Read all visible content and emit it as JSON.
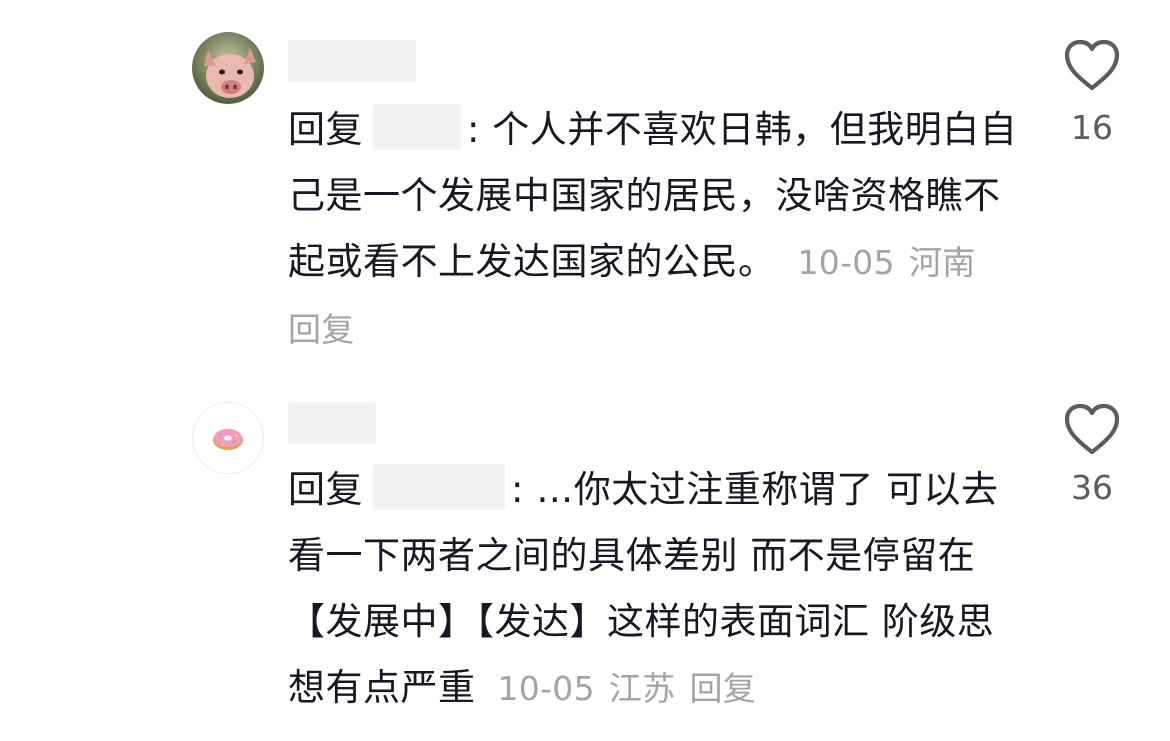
{
  "comments": [
    {
      "mention_prefix": "回复",
      "text": ": 个人并不喜欢日韩，但我明白自己是一个发展中国家的居民，没啥资格瞧不起或看不上发达国家的公民。",
      "date": "10-05",
      "location": "河南",
      "reply_label": "回复",
      "likes": "16",
      "avatar_icon": "pig-face-icon"
    },
    {
      "mention_prefix": "回复",
      "text": ": …你太过注重称谓了 可以去看一下两者之间的具体差别 而不是停留在【发展中】【发达】这样的表面词汇 阶级思想有点严重",
      "date": "10-05",
      "location": "江苏",
      "reply_label": "回复",
      "likes": "36",
      "avatar_icon": "donut-icon"
    }
  ],
  "icons": {
    "like": "heart-outline-icon"
  },
  "colors": {
    "text": "#161823",
    "meta": "#a3a3a8",
    "blur": "#f2f2f2"
  }
}
